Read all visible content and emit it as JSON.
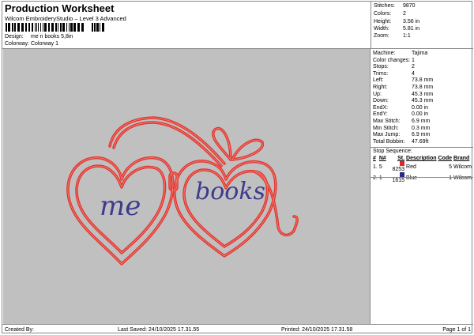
{
  "header": {
    "title": "Production Worksheet",
    "subtitle": "Wilcom EmbroideryStudio – Level 3 Advanced",
    "design_label": "Design:",
    "design_value": "me n books 5,8in",
    "colorway_label": "Colorway:",
    "colorway_value": "Colorway 1"
  },
  "stats": [
    {
      "label": "Stitches:",
      "value": "9870"
    },
    {
      "label": "Colors:",
      "value": "2"
    },
    {
      "label": "Height:",
      "value": "3.56 in"
    },
    {
      "label": "Width:",
      "value": "5.81 in"
    },
    {
      "label": "Zoom:",
      "value": "1:1"
    }
  ],
  "info": [
    {
      "label": "Machine:",
      "value": "Tajima"
    },
    {
      "label": "Color changes:",
      "value": "1"
    },
    {
      "label": "Stops:",
      "value": "2"
    },
    {
      "label": "Trims:",
      "value": "4"
    },
    {
      "label": "Left:",
      "value": "73.8 mm"
    },
    {
      "label": "Right:",
      "value": "73.8 mm"
    },
    {
      "label": "Up:",
      "value": "45.3 mm"
    },
    {
      "label": "Down:",
      "value": "45.3 mm"
    },
    {
      "label": "EndX:",
      "value": "0.00 in"
    },
    {
      "label": "EndY:",
      "value": "0.00 in"
    },
    {
      "label": "Max Stitch:",
      "value": "6.9 mm"
    },
    {
      "label": "Min Stitch:",
      "value": "0.3 mm"
    },
    {
      "label": "Max Jump:",
      "value": "6.9 mm"
    },
    {
      "label": "Total Bobbin:",
      "value": "47.69ft"
    }
  ],
  "stop_sequence": {
    "title": "Stop Sequence:",
    "headers": [
      "#",
      "N#",
      "St.",
      "Description",
      "Code",
      "Brand"
    ],
    "rows": [
      {
        "num": "1.",
        "n": "5",
        "color": "#e0282a",
        "st": "8253",
        "desc": "Red",
        "code": "5",
        "brand": "Wilcom"
      },
      {
        "num": "2.",
        "n": "1",
        "color": "#2a2a80",
        "st": "1615",
        "desc": "Blue",
        "code": "1",
        "brand": "Wilcom"
      }
    ]
  },
  "design": {
    "text_left": "me",
    "text_right": "books",
    "outline_color": "#e0342f",
    "text_color": "#3f3a8c"
  },
  "footer": {
    "created_by": "Created By:",
    "last_saved": "Last Saved: 24/10/2025 17.31.55",
    "printed": "Printed: 24/10/2025 17.31.58",
    "page": "Page 1 of 1"
  }
}
